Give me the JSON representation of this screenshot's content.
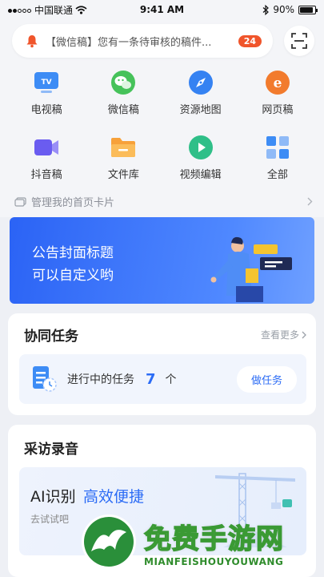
{
  "status_bar": {
    "carrier": "中国联通",
    "time": "9:41 AM",
    "battery": "90%",
    "battery_level": 0.9
  },
  "notice": {
    "text": "【微信稿】您有一条待审核的稿件...",
    "badge": "24"
  },
  "grid": [
    {
      "label": "电视稿",
      "icon": "tv-icon"
    },
    {
      "label": "微信稿",
      "icon": "wechat-icon"
    },
    {
      "label": "资源地图",
      "icon": "compass-icon"
    },
    {
      "label": "网页稿",
      "icon": "web-icon"
    },
    {
      "label": "抖音稿",
      "icon": "video-camera-icon"
    },
    {
      "label": "文件库",
      "icon": "folder-icon"
    },
    {
      "label": "视频编辑",
      "icon": "play-icon"
    },
    {
      "label": "全部",
      "icon": "grid-icon"
    }
  ],
  "manage": {
    "label": "管理我的首页卡片"
  },
  "banner": {
    "line1": "公告封面标题",
    "line2": "可以自定义哟"
  },
  "task_card": {
    "title": "协同任务",
    "more": "查看更多",
    "label": "进行中的任务",
    "count": "7",
    "unit": "个",
    "button": "做任务"
  },
  "record_card": {
    "title": "采访录音",
    "ai": "AI识别",
    "efficient": "高效便捷",
    "try": "去试试吧"
  },
  "watermark": {
    "cn": "免费手游网",
    "en": "MIANFEISHOUYOUWANG"
  },
  "colors": {
    "accent": "#2c6cf5",
    "badge": "#f0552b",
    "banner": "#3a74fa"
  }
}
